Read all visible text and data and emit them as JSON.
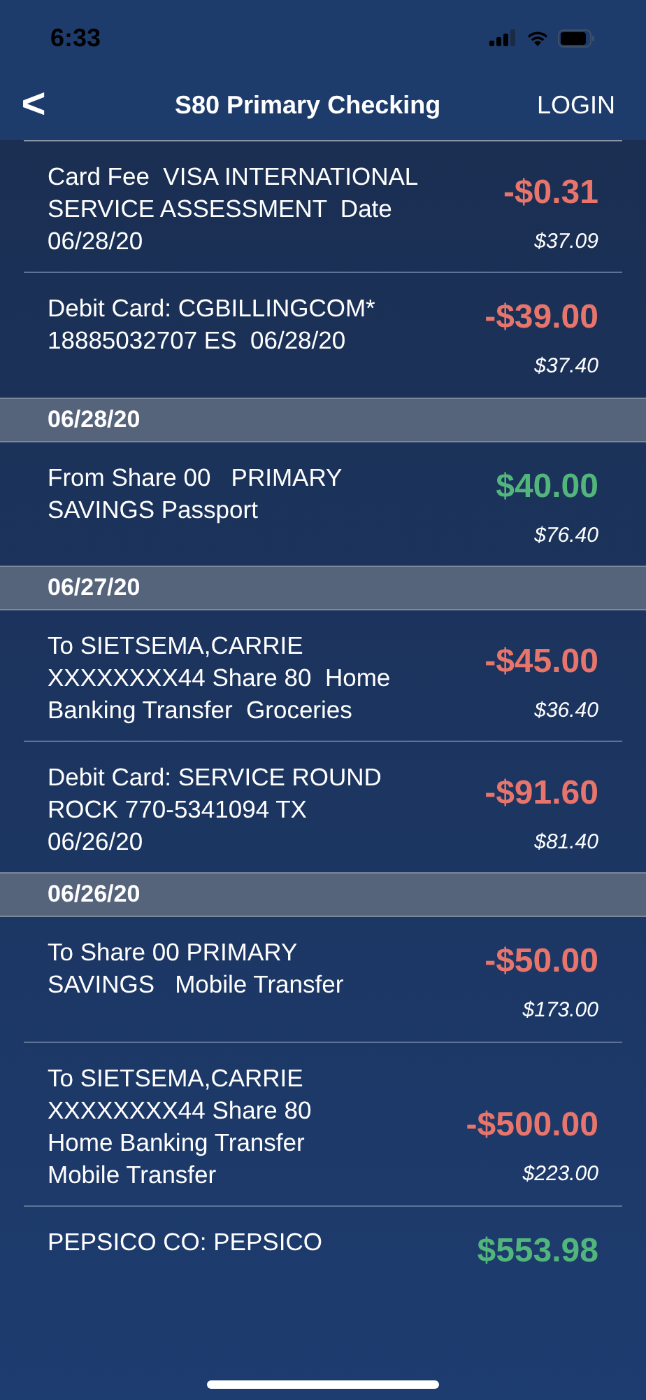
{
  "status_bar": {
    "time": "6:33"
  },
  "nav": {
    "back": "<",
    "title": "S80 Primary Checking",
    "action": "LOGIN"
  },
  "items": [
    {
      "kind": "transaction",
      "description": "Card Fee  VISA INTERNATIONAL\nSERVICE ASSESSMENT  Date\n06/28/20",
      "amount": "-$0.31",
      "color": "#e8756c",
      "balance": "$37.09"
    },
    {
      "kind": "transaction",
      "description": "Debit Card: CGBILLINGCOM*\n18885032707 ES  06/28/20",
      "amount": "-$39.00",
      "color": "#e8756c",
      "balance": "$37.40"
    },
    {
      "kind": "date_header",
      "date": "06/28/20"
    },
    {
      "kind": "transaction",
      "description": "From Share 00   PRIMARY\nSAVINGS Passport",
      "amount": "$40.00",
      "color": "#52b57c",
      "balance": "$76.40"
    },
    {
      "kind": "date_header",
      "date": "06/27/20"
    },
    {
      "kind": "transaction",
      "description": "To SIETSEMA,CARRIE\nXXXXXXXX44 Share 80  Home\nBanking Transfer  Groceries",
      "amount": "-$45.00",
      "color": "#e8756c",
      "balance": "$36.40"
    },
    {
      "kind": "transaction",
      "description": "Debit Card: SERVICE ROUND\nROCK 770-5341094 TX\n06/26/20",
      "amount": "-$91.60",
      "color": "#e8756c",
      "balance": "$81.40"
    },
    {
      "kind": "date_header",
      "date": "06/26/20"
    },
    {
      "kind": "transaction",
      "description": "To Share 00 PRIMARY\nSAVINGS   Mobile Transfer",
      "amount": "-$50.00",
      "color": "#e8756c",
      "balance": "$173.00"
    },
    {
      "kind": "transaction",
      "description": "To SIETSEMA,CARRIE\nXXXXXXXX44 Share 80\nHome Banking Transfer\nMobile Transfer",
      "amount": "-$500.00",
      "color": "#e8756c",
      "balance": "$223.00"
    },
    {
      "kind": "transaction",
      "description": "PEPSICO CO: PEPSICO",
      "amount": "$553.98",
      "color": "#52b57c"
    }
  ]
}
